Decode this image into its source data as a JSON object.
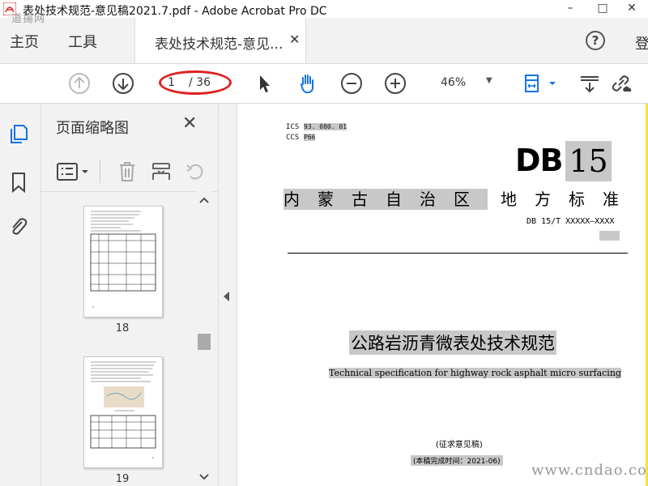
{
  "window": {
    "title": "表处技术规范-意见稿2021.7.pdf - Adobe Acrobat Pro DC",
    "minimize": "–",
    "maximize": "□",
    "close": "✕"
  },
  "tabs": {
    "home": "主页",
    "tools": "工具",
    "document": "表处技术规范-意见...",
    "document_close": "✕",
    "help": "?",
    "signin": "登"
  },
  "toolbar": {
    "page_current": "1",
    "page_total": "/ 36",
    "zoom": "46%",
    "zoom_arrow": "▼"
  },
  "panel": {
    "title": "页面缩略图",
    "close": "✕",
    "thumbnails": [
      {
        "page": "18"
      },
      {
        "page": "19"
      }
    ]
  },
  "document": {
    "ics_label": "ICS",
    "ics_value": "93. 080. 01",
    "ccs_label": "CCS",
    "ccs_value": "P66",
    "db_letters": "DB",
    "db_number": "15",
    "region_a": "内蒙古自治区",
    "region_b": "地方标准",
    "db_code": "DB 15/T XXXXX—XXXX",
    "title_cn": "公路岩沥青微表处技术规范",
    "title_en": "Technical specification for highway rock asphalt micro surfacing",
    "draft_note": "(征求意见稿)",
    "date_note": "(本稿完成时间：2021-06)"
  },
  "watermarks": {
    "top_left": "道揚网",
    "bottom_right": "www.cndao.com"
  },
  "colors": {
    "frame": "#f7e23b",
    "highlight": "#c8c8c8",
    "annotation": "#e02020",
    "acrobat_red": "#d7282f"
  }
}
